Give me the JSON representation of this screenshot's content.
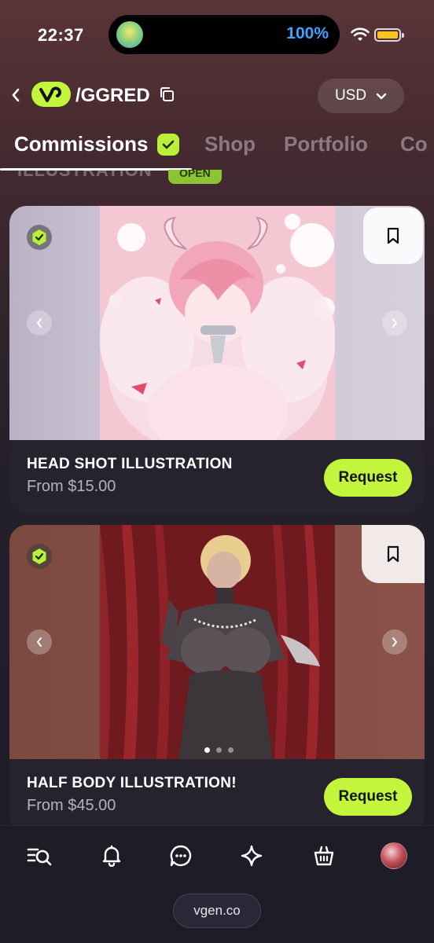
{
  "status_bar": {
    "time": "22:37",
    "battery_percent": "100%"
  },
  "header": {
    "handle": "/GGRED",
    "currency": "USD"
  },
  "tabs": [
    {
      "label": "Commissions"
    },
    {
      "label": "Shop"
    },
    {
      "label": "Portfolio"
    },
    {
      "label": "Co"
    }
  ],
  "section": {
    "title": "ILLUSTRATION",
    "badge": "OPEN"
  },
  "cards": [
    {
      "title": "HEAD SHOT ILLUSTRATION",
      "price": "From $15.00",
      "cta": "Request"
    },
    {
      "title": "HALF BODY ILLUSTRATION!",
      "price": "From $45.00",
      "cta": "Request"
    }
  ],
  "bottom_nav": [
    "explore-icon",
    "bell-icon",
    "chat-icon",
    "sparkle-icon",
    "shop-bag-icon",
    "avatar"
  ],
  "footer": {
    "url": "vgen.co"
  },
  "colors": {
    "accent": "#c2f53c",
    "background": "#1e1c27",
    "battery_text": "#3fa4ff"
  }
}
